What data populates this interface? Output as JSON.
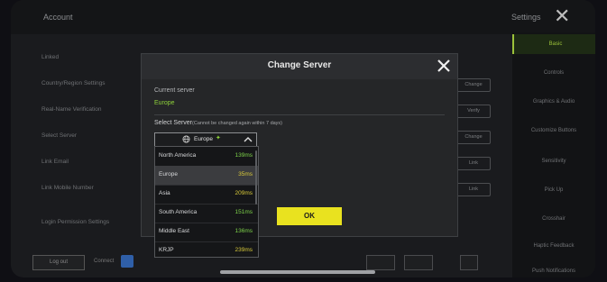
{
  "background": {
    "top_title": "Account",
    "settings_label": "Settings",
    "left_rows": [
      "Linked",
      "Country/Region Settings",
      "Real-Name Verification",
      "Select Server",
      "Link Email",
      "Link Mobile Number",
      "Login Permission Settings"
    ],
    "right_tabs": [
      "Basic",
      "Controls",
      "Graphics & Audio",
      "Customize Buttons",
      "Sensitivity",
      "Pick Up",
      "Crosshair",
      "Haptic Feedback",
      "Push Notifications"
    ],
    "pills": [
      "Change",
      "Verify",
      "Change",
      "Link",
      "Link"
    ],
    "logout_label": "Log out",
    "connect_label": "Connect"
  },
  "modal": {
    "title": "Change Server",
    "current_server_label": "Current server",
    "current_server_value": "Europe",
    "select_server_label": "Select Server",
    "select_server_note": "(Cannot be changed again within 7 days)",
    "selected_value": "Europe",
    "servers": [
      {
        "name": "North America",
        "ping": "139ms",
        "ping_color": "green"
      },
      {
        "name": "Europe",
        "ping": "35ms",
        "ping_color": "yellow"
      },
      {
        "name": "Asia",
        "ping": "209ms",
        "ping_color": "yellow"
      },
      {
        "name": "South America",
        "ping": "151ms",
        "ping_color": "green"
      },
      {
        "name": "Middle East",
        "ping": "136ms",
        "ping_color": "green"
      },
      {
        "name": "KRJP",
        "ping": "239ms",
        "ping_color": "yellow"
      }
    ],
    "ok_label": "OK"
  },
  "colors": {
    "accent_green": "#8ed13a",
    "ok_yellow": "#e9e21f"
  }
}
